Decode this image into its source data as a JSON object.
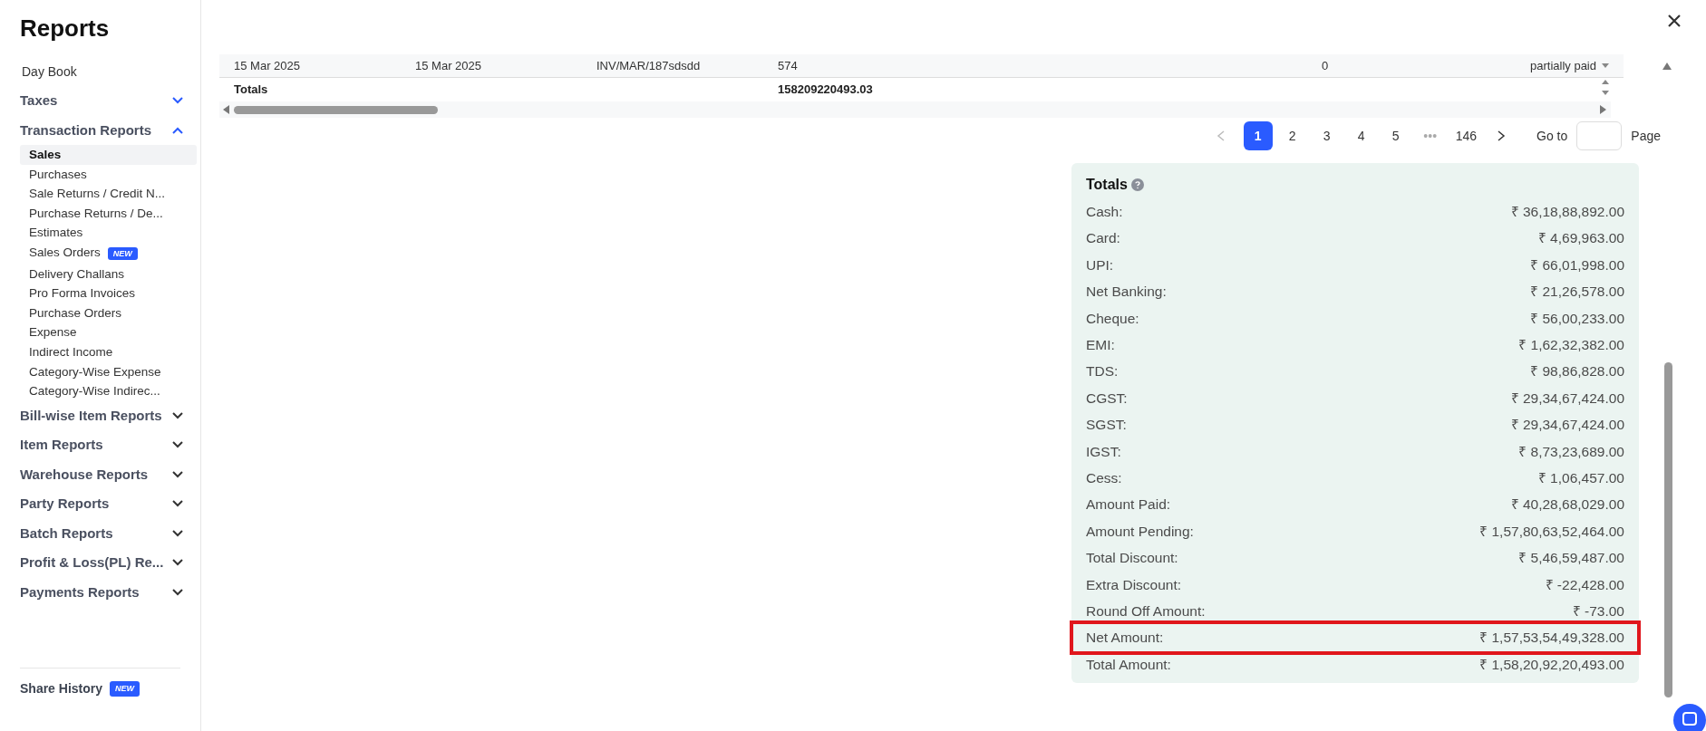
{
  "title": "Reports",
  "sidebar": {
    "items": [
      {
        "kind": "link",
        "label": "Day Book"
      },
      {
        "kind": "group",
        "label": "Taxes",
        "expanded": false,
        "accent": true
      },
      {
        "kind": "group",
        "label": "Transaction Reports",
        "expanded": true,
        "accent": true,
        "children": [
          {
            "label": "Sales",
            "selected": true
          },
          {
            "label": "Purchases",
            "selected": false
          },
          {
            "label": "Sale Returns / Credit N...",
            "selected": false
          },
          {
            "label": "Purchase Returns / De...",
            "selected": false
          },
          {
            "label": "Estimates",
            "selected": false
          },
          {
            "label": "Sales Orders",
            "selected": false,
            "badge": "NEW"
          },
          {
            "label": "Delivery Challans",
            "selected": false
          },
          {
            "label": "Pro Forma Invoices",
            "selected": false
          },
          {
            "label": "Purchase Orders",
            "selected": false
          },
          {
            "label": "Expense",
            "selected": false
          },
          {
            "label": "Indirect Income",
            "selected": false
          },
          {
            "label": "Category-Wise Expense",
            "selected": false
          },
          {
            "label": "Category-Wise Indirec...",
            "selected": false
          }
        ]
      },
      {
        "kind": "group",
        "label": "Bill-wise Item Reports",
        "expanded": false,
        "accent": false
      },
      {
        "kind": "group",
        "label": "Item Reports",
        "expanded": false,
        "accent": false
      },
      {
        "kind": "group",
        "label": "Warehouse Reports",
        "expanded": false,
        "accent": false
      },
      {
        "kind": "group",
        "label": "Party Reports",
        "expanded": false,
        "accent": false
      },
      {
        "kind": "group",
        "label": "Batch Reports",
        "expanded": false,
        "accent": false
      },
      {
        "kind": "group",
        "label": "Profit & Loss(PL) Re...",
        "expanded": false,
        "accent": false
      },
      {
        "kind": "group",
        "label": "Payments Reports",
        "expanded": false,
        "accent": false
      }
    ],
    "share_history": {
      "label": "Share History",
      "badge": "NEW"
    }
  },
  "table": {
    "rows": [
      {
        "kind": "data",
        "cells": [
          "15 Mar 2025",
          "15 Mar 2025",
          "INV/MAR/187sdsdd",
          "574",
          "",
          "0",
          "partially paid"
        ]
      },
      {
        "kind": "totals",
        "cells": [
          "Totals",
          "",
          "",
          "158209220493.03",
          "",
          "",
          ""
        ]
      }
    ]
  },
  "pagination": {
    "pages": [
      {
        "label": "1",
        "selected": true
      },
      {
        "label": "2",
        "selected": false
      },
      {
        "label": "3",
        "selected": false
      },
      {
        "label": "4",
        "selected": false
      },
      {
        "label": "5",
        "selected": false
      },
      {
        "label": "•••",
        "kind": "ellipsis",
        "selected": false
      },
      {
        "label": "146",
        "selected": false
      }
    ],
    "goto_label": "Go to",
    "page_label": "Page"
  },
  "totals": {
    "title": "Totals",
    "rows": [
      {
        "label": "Cash:",
        "value": "₹ 36,18,88,892.00",
        "highlighted": false
      },
      {
        "label": "Card:",
        "value": "₹ 4,69,963.00",
        "highlighted": false
      },
      {
        "label": "UPI:",
        "value": "₹ 66,01,998.00",
        "highlighted": false
      },
      {
        "label": "Net Banking:",
        "value": "₹ 21,26,578.00",
        "highlighted": false
      },
      {
        "label": "Cheque:",
        "value": "₹ 56,00,233.00",
        "highlighted": false
      },
      {
        "label": "EMI:",
        "value": "₹ 1,62,32,382.00",
        "highlighted": false
      },
      {
        "label": "TDS:",
        "value": "₹ 98,86,828.00",
        "highlighted": false
      },
      {
        "label": "CGST:",
        "value": "₹ 29,34,67,424.00",
        "highlighted": false
      },
      {
        "label": "SGST:",
        "value": "₹ 29,34,67,424.00",
        "highlighted": false
      },
      {
        "label": "IGST:",
        "value": "₹ 8,73,23,689.00",
        "highlighted": false
      },
      {
        "label": "Cess:",
        "value": "₹ 1,06,457.00",
        "highlighted": false
      },
      {
        "label": "Amount Paid:",
        "value": "₹ 40,28,68,029.00",
        "highlighted": false
      },
      {
        "label": "Amount Pending:",
        "value": "₹ 1,57,80,63,52,464.00",
        "highlighted": false
      },
      {
        "label": "Total Discount:",
        "value": "₹ 5,46,59,487.00",
        "highlighted": false
      },
      {
        "label": "Extra Discount:",
        "value": "₹ -22,428.00",
        "highlighted": false
      },
      {
        "label": "Round Off Amount:",
        "value": "₹ -73.00",
        "highlighted": false
      },
      {
        "label": "Net Amount:",
        "value": "₹ 1,57,53,54,49,328.00",
        "highlighted": true
      },
      {
        "label": "Total Amount:",
        "value": "₹ 1,58,20,92,20,493.00",
        "highlighted": false
      }
    ]
  }
}
